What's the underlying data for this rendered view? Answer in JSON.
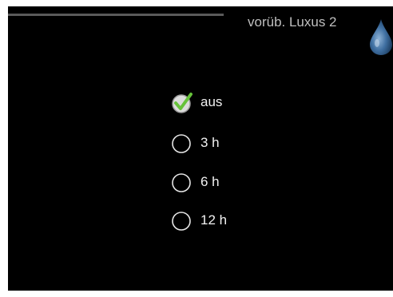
{
  "header": {
    "title": "vorüb. Luxus 2",
    "icon": "water-drop-icon"
  },
  "options": [
    {
      "label": "aus",
      "selected": true
    },
    {
      "label": "3 h",
      "selected": false
    },
    {
      "label": "6 h",
      "selected": false
    },
    {
      "label": "12 h",
      "selected": false
    }
  ],
  "colors": {
    "background": "#000000",
    "text": "#f2f2f2",
    "title": "#bfbfbf",
    "check": "#66c23a",
    "drop": "#3f6fa1"
  }
}
